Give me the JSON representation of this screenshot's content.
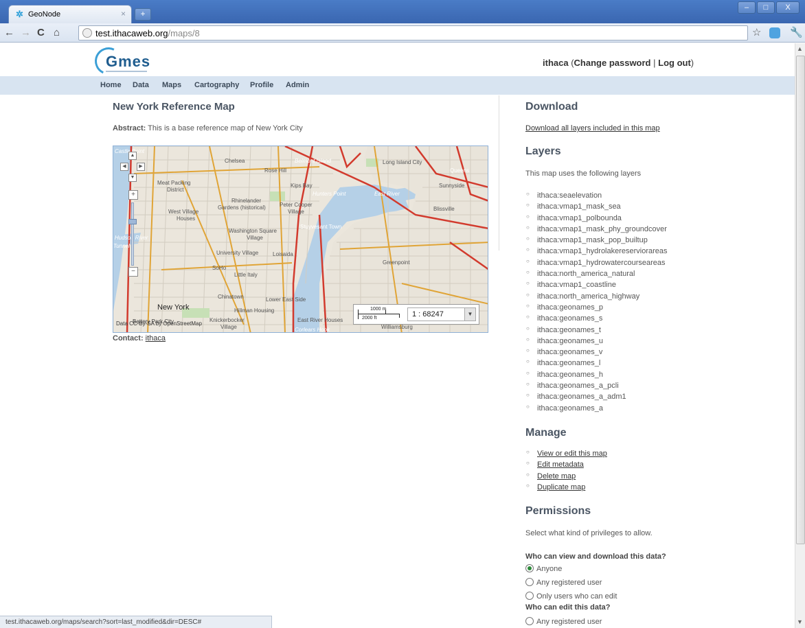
{
  "browser": {
    "tab_title": "GeoNode",
    "tab_close": "×",
    "new_tab": "+",
    "url_host": "test.ithacaweb.org",
    "url_path": "/maps/8",
    "back": "←",
    "forward": "→",
    "reload": "C",
    "home": "⌂",
    "star": "☆",
    "wrench": "🔧",
    "minimize": "–",
    "maximize": "□",
    "close": "X"
  },
  "header": {
    "logo_text": "Gmes",
    "username": "ithaca",
    "change_password": "Change password",
    "separator": "|",
    "logout": "Log out"
  },
  "nav": [
    "Home",
    "Data",
    "Maps",
    "Cartography",
    "Profile",
    "Admin"
  ],
  "main": {
    "title": "New York Reference Map",
    "abstract_label": "Abstract:",
    "abstract_text": "This is a base reference map of New York City",
    "contact_label": "Contact:",
    "contact_value": "ithaca",
    "map": {
      "scale_value": "1 : 68247",
      "scale_bar_top": "1000 m",
      "scale_bar_bottom": "2000 ft",
      "attribution": "Data CC-By-SA by OpenStreetMap",
      "places": [
        "Castle Point",
        "Chelsea",
        "Rose Hill",
        "Belmont Island",
        "Long Island City",
        "Queens",
        "Sunnyside",
        "Meat Packing District",
        "Kips Bay",
        "Hunters Point",
        "East River",
        "Blissville",
        "Rhinelander Gardens (historical)",
        "Peter Cooper Village",
        "West Village",
        "Stuyvesant Town",
        "Washington Square Village",
        "Hudson River",
        "University Village",
        "Loisaida",
        "SoHo",
        "Little Italy",
        "Greenpoint",
        "Chinatown",
        "Lower East Side",
        "New York",
        "Hillman Housing",
        "Knickerbocker Village",
        "East River Houses",
        "Corlears Hook",
        "Williamsburg",
        "Battery Park City"
      ]
    }
  },
  "sidebar": {
    "download_title": "Download",
    "download_link": "Download all layers included in this map",
    "layers_title": "Layers",
    "layers_intro": "This map uses the following layers",
    "layers": [
      "ithaca:seaelevation",
      "ithaca:vmap1_mask_sea",
      "ithaca:vmap1_polbounda",
      "ithaca:vmap1_mask_phy_groundcover",
      "ithaca:vmap1_mask_pop_builtup",
      "ithaca:vmap1_hydrolakereserviorareas",
      "ithaca:vmap1_hydrowatercourseareas",
      "ithaca:north_america_natural",
      "ithaca:vmap1_coastline",
      "ithaca:north_america_highway",
      "ithaca:geonames_p",
      "ithaca:geonames_s",
      "ithaca:geonames_t",
      "ithaca:geonames_u",
      "ithaca:geonames_v",
      "ithaca:geonames_l",
      "ithaca:geonames_h",
      "ithaca:geonames_a_pcli",
      "ithaca:geonames_a_adm1",
      "ithaca:geonames_a"
    ],
    "manage_title": "Manage",
    "manage_links": [
      "View or edit this map",
      "Edit metadata",
      "Delete map",
      "Duplicate map"
    ],
    "permissions_title": "Permissions",
    "permissions_intro": "Select what kind of privileges to allow.",
    "view_question": "Who can view and download this data?",
    "view_options": [
      "Anyone",
      "Any registered user",
      "Only users who can edit"
    ],
    "view_selected": 0,
    "edit_question": "Who can edit this data?",
    "edit_options": [
      "Any registered user"
    ]
  },
  "status_bar": "test.ithacaweb.org/maps/search?sort=last_modified&dir=DESC#"
}
